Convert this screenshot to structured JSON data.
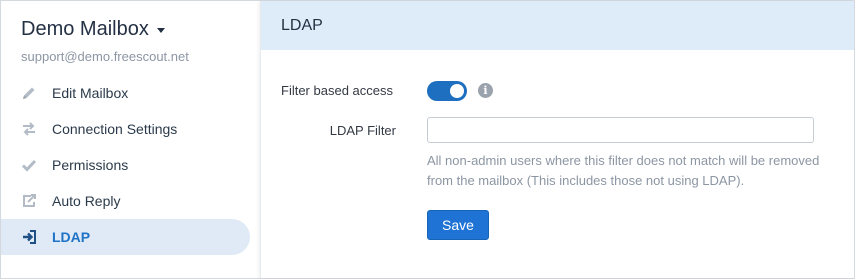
{
  "sidebar": {
    "mailbox_name": "Demo Mailbox",
    "mailbox_email": "support@demo.freescout.net",
    "items": [
      {
        "label": "Edit Mailbox",
        "icon": "pencil-icon"
      },
      {
        "label": "Connection Settings",
        "icon": "swap-arrows-icon"
      },
      {
        "label": "Permissions",
        "icon": "checkmark-icon"
      },
      {
        "label": "Auto Reply",
        "icon": "share-icon"
      },
      {
        "label": "LDAP",
        "icon": "sign-in-icon",
        "active": true
      }
    ]
  },
  "main": {
    "title": "LDAP",
    "filter_access_label": "Filter based access",
    "filter_access_enabled": true,
    "ldap_filter_label": "LDAP Filter",
    "ldap_filter_value": "",
    "help_text": "All non-admin users where this filter does not match will be removed from the mailbox (This includes those not using LDAP).",
    "save_label": "Save",
    "info_glyph": "i"
  },
  "colors": {
    "header_bg": "#deebf8",
    "active_nav_bg": "#dfeaf6",
    "accent": "#1e73d4"
  }
}
